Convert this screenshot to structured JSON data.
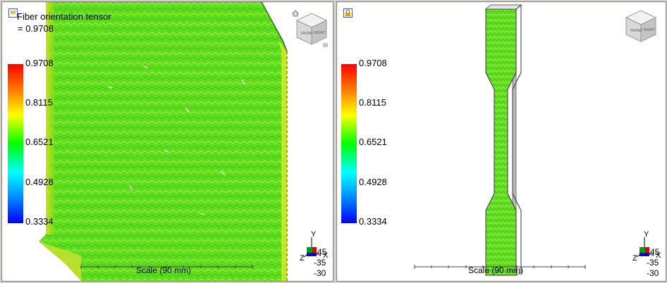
{
  "left_view": {
    "title": "Fiber orientation tensor",
    "title_value": "= 0.9708",
    "legend": [
      "0.9708",
      "0.8115",
      "0.6521",
      "0.4928",
      "0.3334"
    ],
    "scale_label": "Scale (90 mm)",
    "axes": {
      "y": "Y",
      "x": "X",
      "z": "Z"
    },
    "angles": [
      "45",
      "-35",
      "-30"
    ],
    "icons": [
      "view-pin-icon",
      "home-icon",
      "view-cube-icon",
      "menu-icon"
    ]
  },
  "right_view": {
    "legend": [
      "0.9708",
      "0.8115",
      "0.6521",
      "0.4928",
      "0.3334"
    ],
    "scale_label": "Scale (90 mm)",
    "axes": {
      "y": "Y",
      "x": "X",
      "z": "Z"
    },
    "angles": [
      "45",
      "-35",
      "-30"
    ],
    "icons": [
      "lock-icon",
      "view-cube-icon"
    ]
  },
  "colors": {
    "mesh_green": "#66e01a",
    "mesh_yellow": "#d8e820",
    "legend_top": "#ff0000",
    "legend_bottom": "#0000ff"
  }
}
